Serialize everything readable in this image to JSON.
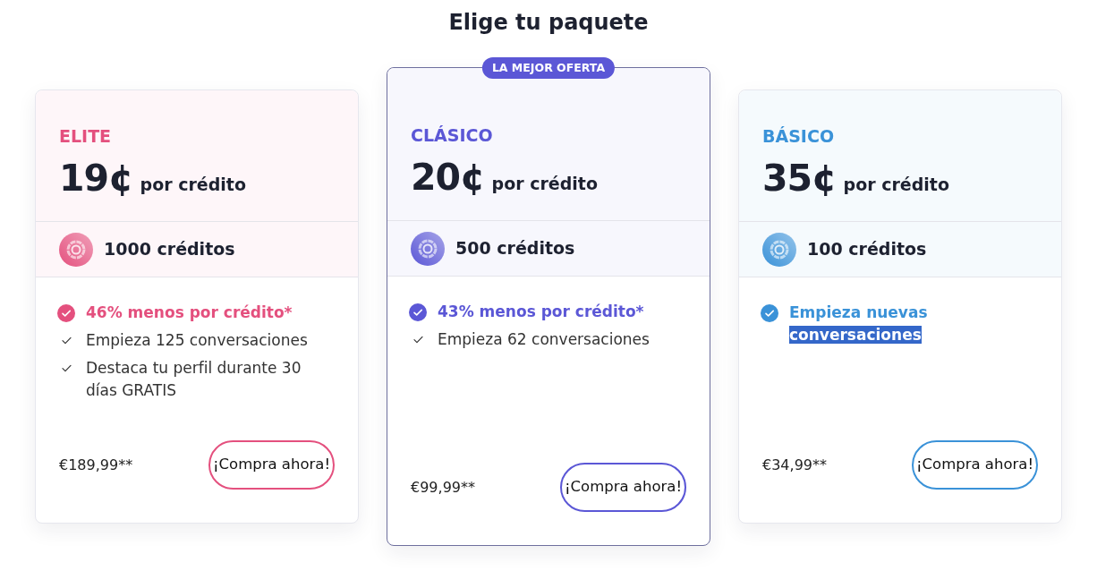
{
  "title": "Elige tu paquete",
  "plans": [
    {
      "name": "ELITE",
      "color": "#e4507e",
      "featured": false,
      "price": "19¢",
      "price_unit": "por crédito",
      "credits": "1000 créditos",
      "features": [
        {
          "kind": "highlight",
          "parts": [
            {
              "text": "46% menos por crédito*",
              "highlighted": false
            }
          ]
        },
        {
          "kind": "standard",
          "parts": [
            {
              "text": "Empieza 125 conversaciones",
              "highlighted": false
            }
          ]
        },
        {
          "kind": "standard",
          "parts": [
            {
              "text": "Destaca tu perfil durante 30 días GRATIS",
              "highlighted": false
            }
          ]
        }
      ],
      "total": "€189,99**",
      "button": "¡Compra ahora!"
    },
    {
      "name": "CLÁSICO",
      "color": "#5b57d6",
      "featured": true,
      "badge": "LA MEJOR OFERTA",
      "price": "20¢",
      "price_unit": "por crédito",
      "credits": "500 créditos",
      "features": [
        {
          "kind": "highlight",
          "parts": [
            {
              "text": "43% menos por crédito*",
              "highlighted": false
            }
          ]
        },
        {
          "kind": "standard",
          "parts": [
            {
              "text": "Empieza 62 conversaciones",
              "highlighted": false
            }
          ]
        }
      ],
      "total": "€99,99**",
      "button": "¡Compra ahora!"
    },
    {
      "name": "BÁSICO",
      "color": "#3a92d8",
      "featured": false,
      "price": "35¢",
      "price_unit": "por crédito",
      "credits": "100 créditos",
      "features": [
        {
          "kind": "highlight",
          "parts": [
            {
              "text": "Empieza nuevas",
              "highlighted": false
            },
            {
              "text": "conversaciones",
              "highlighted": true
            }
          ]
        }
      ],
      "total": "€34,99**",
      "button": "¡Compra ahora!"
    }
  ]
}
